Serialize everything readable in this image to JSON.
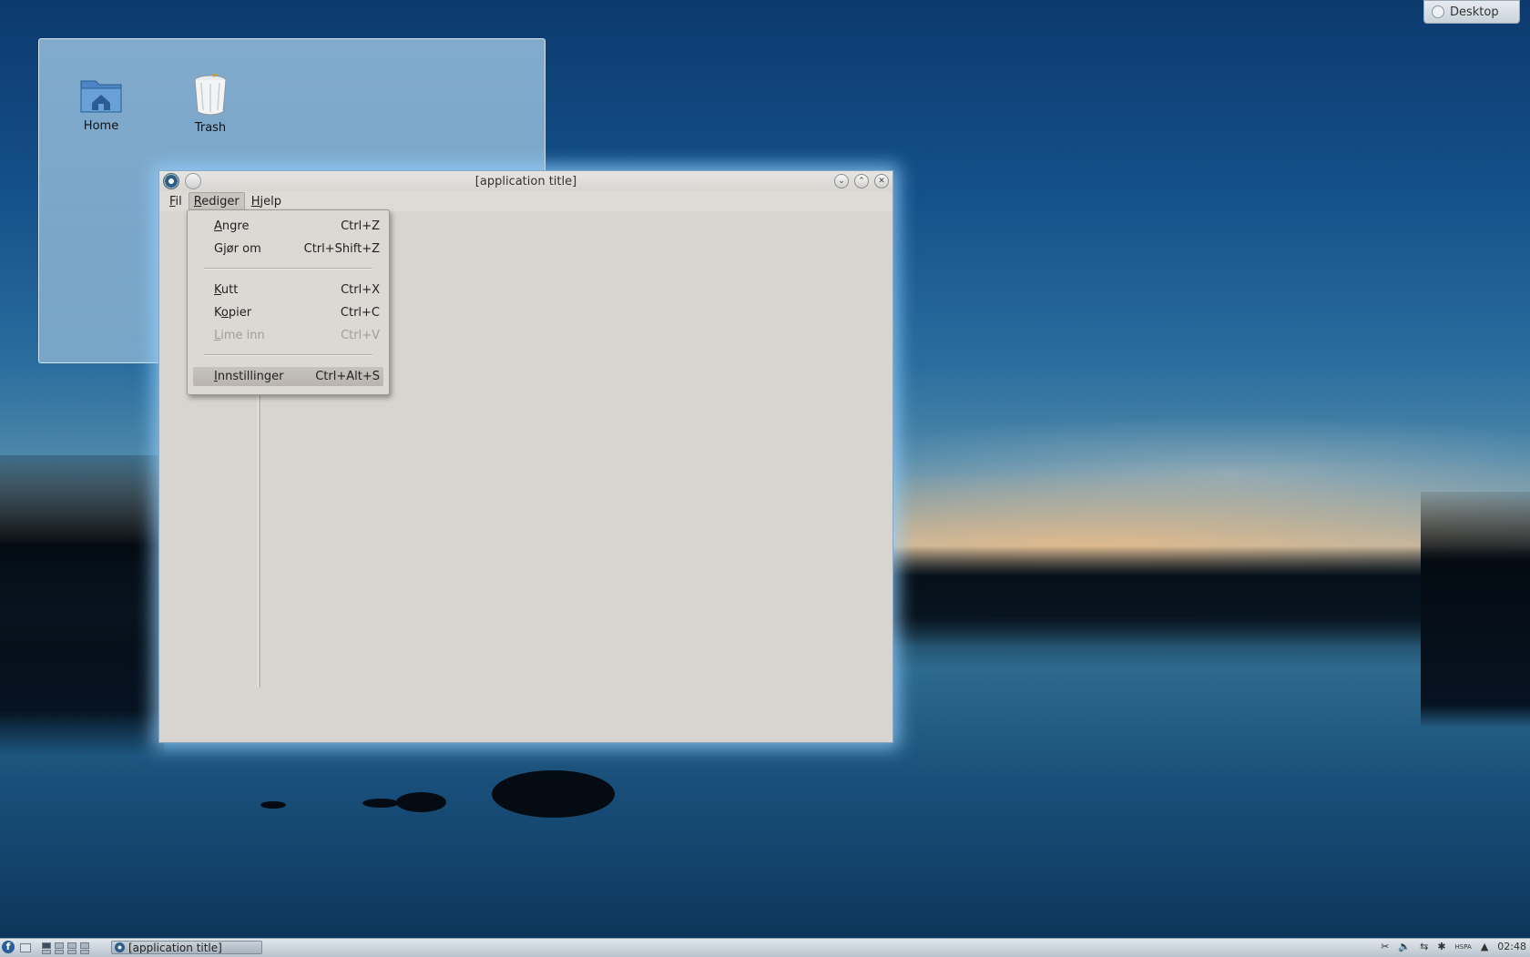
{
  "desktop_button": {
    "label": "Desktop"
  },
  "desktop_icons": [
    {
      "name": "home",
      "label": "Home"
    },
    {
      "name": "trash",
      "label": "Trash"
    }
  ],
  "window": {
    "title": "[application title]",
    "menus": [
      {
        "label": "Fil",
        "u": "F",
        "rest": "il"
      },
      {
        "label": "Rediger",
        "u": "R",
        "rest": "ediger"
      },
      {
        "label": "Hjelp",
        "u": "H",
        "rest": "jelp"
      }
    ],
    "active_menu": "Rediger"
  },
  "edit_menu": {
    "items": [
      {
        "u": "A",
        "rest": "ngre",
        "label": "Angre",
        "shortcut": "Ctrl+Z",
        "enabled": true
      },
      {
        "u": "",
        "rest": "Gjør om",
        "label": "Gjør om",
        "shortcut": "Ctrl+Shift+Z",
        "enabled": true
      },
      {
        "u": "K",
        "rest": "utt",
        "label": "Kutt",
        "shortcut": "Ctrl+X",
        "enabled": true
      },
      {
        "pre": "K",
        "u": "o",
        "rest": "pier",
        "label": "Kopier",
        "shortcut": "Ctrl+C",
        "enabled": true
      },
      {
        "u": "L",
        "rest": "ime inn",
        "label": "Lime inn",
        "shortcut": "Ctrl+V",
        "enabled": false
      },
      {
        "u": "I",
        "rest": "nnstillinger",
        "label": "Innstillinger",
        "shortcut": "Ctrl+Alt+S",
        "enabled": true,
        "highlighted": true
      }
    ]
  },
  "taskbar": {
    "launcher_glyph": "f",
    "task_label": "[application title]",
    "clock": "02:48",
    "tray_badge": "HSPA"
  }
}
